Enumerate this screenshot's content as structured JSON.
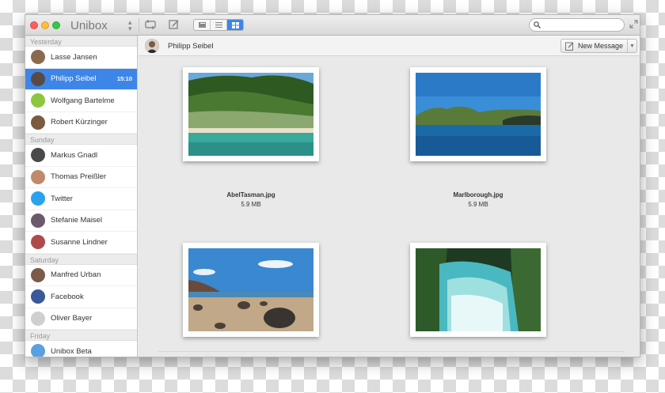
{
  "app": {
    "title": "Unibox"
  },
  "toolbar": {
    "search_placeholder": ""
  },
  "sidebar": {
    "groups": [
      {
        "label": "Yesterday",
        "items": [
          {
            "name": "Lasse Jansen",
            "avatar_color": "#8a6a4e"
          },
          {
            "name": "Philipp Seibel",
            "time": "15:10",
            "selected": true,
            "avatar_color": "#5a4a42"
          },
          {
            "name": "Wolfgang Bartelme",
            "avatar_color": "#8dc63f"
          },
          {
            "name": "Robert Kürzinger",
            "avatar_color": "#7b5a3e"
          }
        ]
      },
      {
        "label": "Sunday",
        "items": [
          {
            "name": "Markus Gnadl",
            "avatar_color": "#4a4a4a"
          },
          {
            "name": "Thomas Preißler",
            "avatar_color": "#c08a6a"
          },
          {
            "name": "Twitter",
            "avatar_color": "#2aa3ef"
          },
          {
            "name": "Stefanie Maisel",
            "avatar_color": "#6a5a6a"
          },
          {
            "name": "Susanne Lindner",
            "avatar_color": "#b04a4a"
          }
        ]
      },
      {
        "label": "Saturday",
        "items": [
          {
            "name": "Manfred Urban",
            "avatar_color": "#7a5a4a"
          },
          {
            "name": "Facebook",
            "avatar_color": "#3b5998"
          },
          {
            "name": "Oliver Bayer",
            "avatar_color": "#cfcfcf"
          }
        ]
      },
      {
        "label": "Friday",
        "items": [
          {
            "name": "Unibox Beta",
            "avatar_color": "#5aa0e0"
          }
        ]
      }
    ]
  },
  "conversation": {
    "contact_name": "Philipp Seibel",
    "new_message_label": "New Message"
  },
  "attachments": [
    {
      "filename": "AbelTasman.jpg",
      "size": "5.9 MB"
    },
    {
      "filename": "Marlborough.jpg",
      "size": "5.9 MB"
    },
    {
      "filename": "",
      "size": ""
    },
    {
      "filename": "",
      "size": ""
    }
  ]
}
